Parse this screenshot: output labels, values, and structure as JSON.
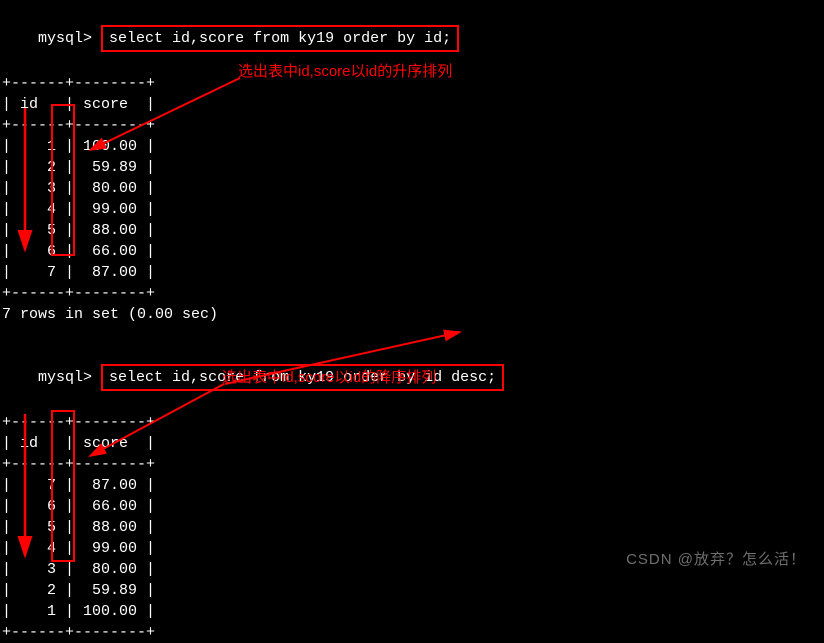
{
  "prompt": "mysql>",
  "queries": {
    "q1": "select id,score from ky19 order by id;",
    "q2": "select id,score from ky19 order by id desc;"
  },
  "table_header": {
    "sep": "+------+--------+",
    "cols": "| id   | score  |"
  },
  "results": {
    "r1": [
      "|    1 | 100.00 |",
      "|    2 |  59.89 |",
      "|    3 |  80.00 |",
      "|    4 |  99.00 |",
      "|    5 |  88.00 |",
      "|    6 |  66.00 |",
      "|    7 |  87.00 |"
    ],
    "r2": [
      "|    7 |  87.00 |",
      "|    6 |  66.00 |",
      "|    5 |  88.00 |",
      "|    4 |  99.00 |",
      "|    3 |  80.00 |",
      "|    2 |  59.89 |",
      "|    1 | 100.00 |"
    ]
  },
  "status": "7 rows in set (0.00 sec)",
  "comments": {
    "c1": "选出表中id,score以id的升序排列",
    "c2": "选出表中id,score以id的降序排列"
  },
  "watermark": "CSDN @放弃？怎么活！",
  "chart_data": [
    {
      "type": "table",
      "title": "ky19 order by id asc",
      "columns": [
        "id",
        "score"
      ],
      "rows": [
        [
          1,
          100.0
        ],
        [
          2,
          59.89
        ],
        [
          3,
          80.0
        ],
        [
          4,
          99.0
        ],
        [
          5,
          88.0
        ],
        [
          6,
          66.0
        ],
        [
          7,
          87.0
        ]
      ]
    },
    {
      "type": "table",
      "title": "ky19 order by id desc",
      "columns": [
        "id",
        "score"
      ],
      "rows": [
        [
          7,
          87.0
        ],
        [
          6,
          66.0
        ],
        [
          5,
          88.0
        ],
        [
          4,
          99.0
        ],
        [
          3,
          80.0
        ],
        [
          2,
          59.89
        ],
        [
          1,
          100.0
        ]
      ]
    }
  ]
}
